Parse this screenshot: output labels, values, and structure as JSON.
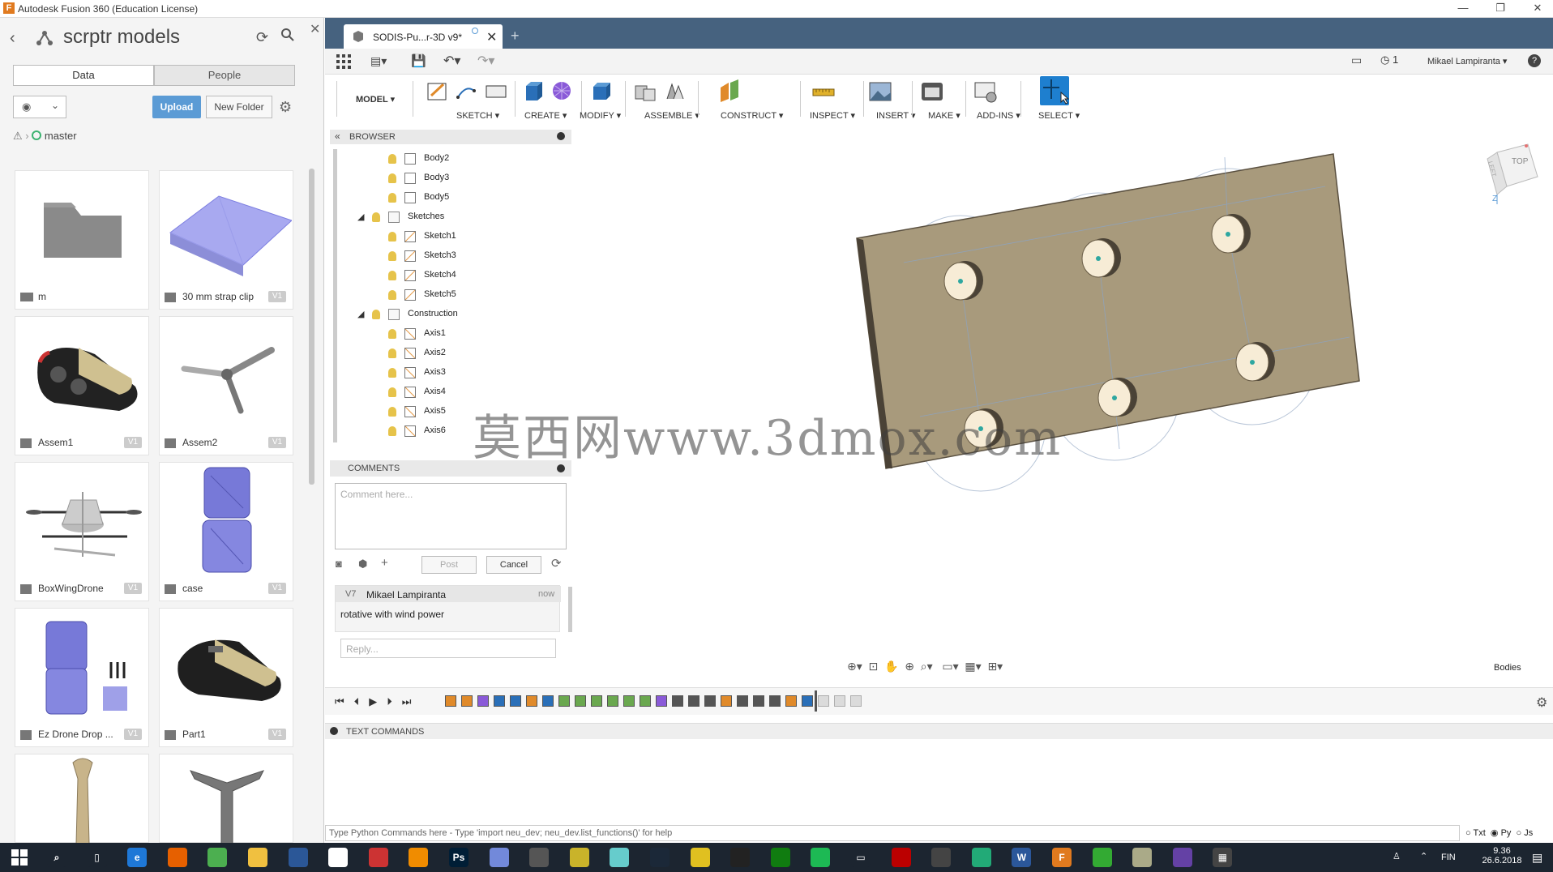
{
  "window": {
    "title": "Autodesk Fusion 360 (Education License)",
    "buttons": [
      "—",
      "❐",
      "✕"
    ]
  },
  "data_panel": {
    "project_title": "scrptr models",
    "tabs": [
      "Data",
      "People"
    ],
    "upload_label": "Upload",
    "new_folder_label": "New Folder",
    "breadcrumb": "master",
    "items": [
      {
        "name": "m",
        "version": "",
        "kind": "folder"
      },
      {
        "name": "30 mm strap clip",
        "version": "V1",
        "kind": "design"
      },
      {
        "name": "Assem1",
        "version": "V1",
        "kind": "design"
      },
      {
        "name": "Assem2",
        "version": "V1",
        "kind": "design"
      },
      {
        "name": "BoxWingDrone",
        "version": "V1",
        "kind": "design"
      },
      {
        "name": "case",
        "version": "V1",
        "kind": "design"
      },
      {
        "name": "Ez Drone Drop ...",
        "version": "V1",
        "kind": "design"
      },
      {
        "name": "Part1",
        "version": "V1",
        "kind": "design"
      },
      {
        "name": "",
        "version": "",
        "kind": "design"
      },
      {
        "name": "",
        "version": "",
        "kind": "design"
      }
    ]
  },
  "document_tab": {
    "title": "SODIS-Pu...r-3D v9*",
    "new_tab_symbol": "+"
  },
  "quick_access": {
    "user": "Mikael Lampiranta ▾",
    "job_count": "1",
    "help": "?"
  },
  "ribbon": {
    "workspace": "MODEL ▾",
    "groups": [
      "SKETCH ▾",
      "CREATE ▾",
      "MODIFY ▾",
      "ASSEMBLE ▾",
      "CONSTRUCT ▾",
      "INSPECT ▾",
      "INSERT ▾",
      "MAKE ▾",
      "ADD-INS ▾",
      "SELECT ▾"
    ]
  },
  "browser": {
    "title": "BROWSER",
    "rows": [
      {
        "label": "Body2",
        "icon": "body-icon",
        "indent": 2
      },
      {
        "label": "Body3",
        "icon": "body-icon",
        "indent": 2
      },
      {
        "label": "Body5",
        "icon": "body-icon",
        "indent": 2
      },
      {
        "label": "Sketches",
        "icon": "folder-icon",
        "indent": 1
      },
      {
        "label": "Sketch1",
        "icon": "sketch-icon",
        "indent": 2
      },
      {
        "label": "Sketch3",
        "icon": "sketch-icon",
        "indent": 2
      },
      {
        "label": "Sketch4",
        "icon": "sketch-icon",
        "indent": 2
      },
      {
        "label": "Sketch5",
        "icon": "sketch-icon",
        "indent": 2
      },
      {
        "label": "Construction",
        "icon": "folder-icon",
        "indent": 1
      },
      {
        "label": "Axis1",
        "icon": "axis-icon",
        "indent": 2
      },
      {
        "label": "Axis2",
        "icon": "axis-icon",
        "indent": 2
      },
      {
        "label": "Axis3",
        "icon": "axis-icon",
        "indent": 2
      },
      {
        "label": "Axis4",
        "icon": "axis-icon",
        "indent": 2
      },
      {
        "label": "Axis5",
        "icon": "axis-icon",
        "indent": 2
      },
      {
        "label": "Axis6",
        "icon": "axis-icon",
        "indent": 2
      }
    ]
  },
  "comments": {
    "title": "COMMENTS",
    "placeholder": "Comment here...",
    "post_label": "Post",
    "cancel_label": "Cancel",
    "entry": {
      "version": "V7",
      "author": "Mikael Lampiranta",
      "time": "now",
      "text": "rotative with wind power"
    },
    "reply_placeholder": "Reply..."
  },
  "viewport": {
    "viewcube_top": "TOP",
    "viewcube_left": "LEFT",
    "axis_label": "Z",
    "watermark": "莫西网www.3dmox.com",
    "selection_filter": "Bodies"
  },
  "text_commands": {
    "title": "TEXT COMMANDS",
    "input_placeholder": "Type Python Commands here - Type 'import neu_dev; neu_dev.list_functions()' for help",
    "modes": [
      "Txt",
      "Py",
      "Js"
    ],
    "selected_mode": "Py"
  },
  "taskbar": {
    "language": "FIN",
    "time": "9.36",
    "date": "26.6.2018"
  },
  "colors": {
    "plate": "#a89a7c",
    "accent_blue": "#5b9bd5",
    "doc_bar": "#46627f",
    "select_highlight": "#1e7fcf"
  }
}
